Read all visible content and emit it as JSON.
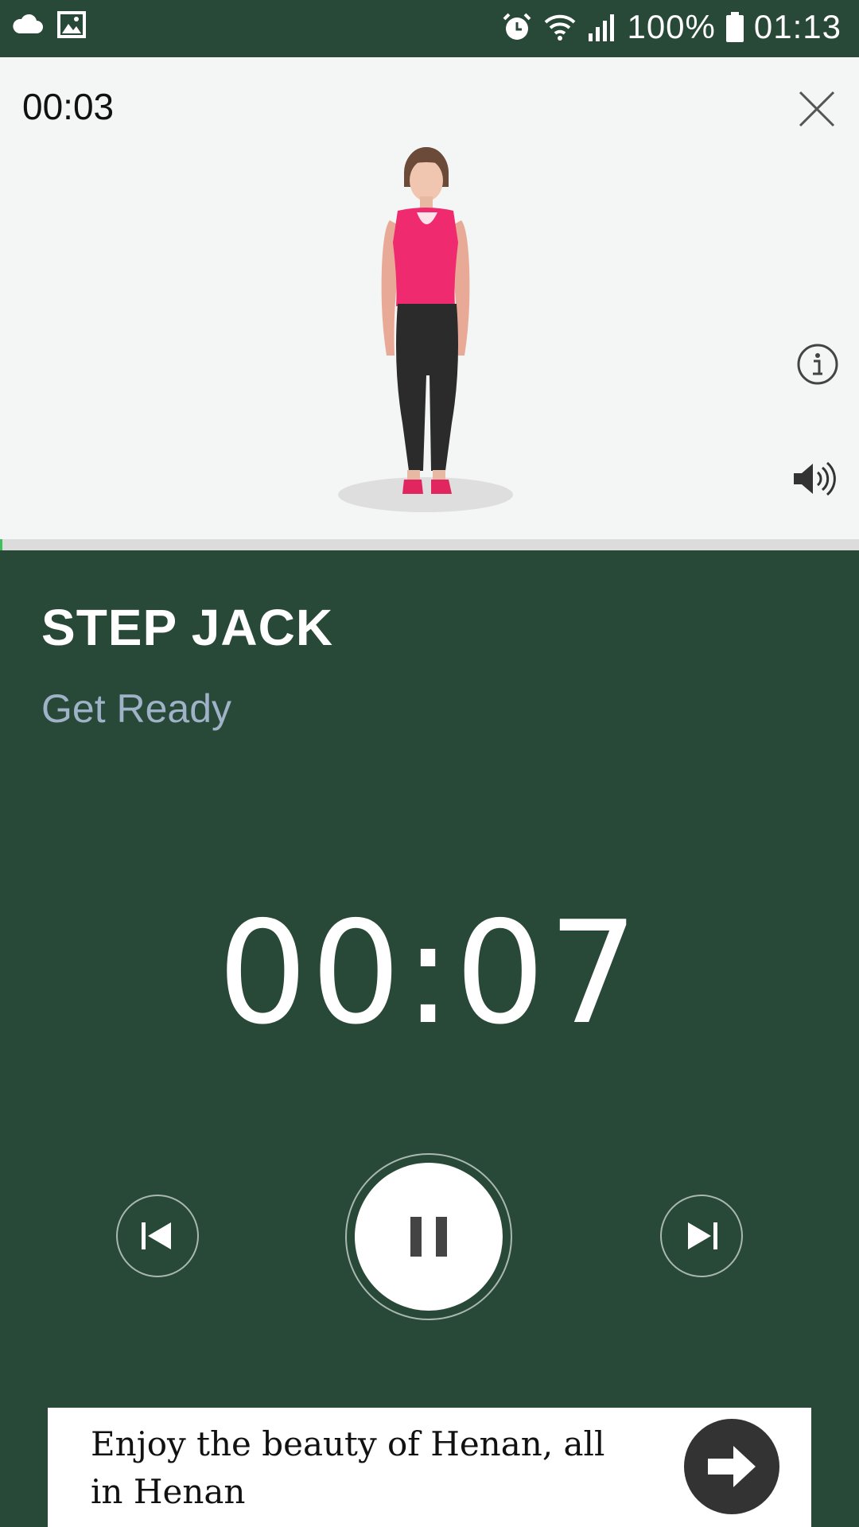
{
  "status_bar": {
    "battery": "100%",
    "time": "01:13",
    "icons": [
      "cloud-icon",
      "gallery-icon",
      "alarm-icon",
      "wifi-icon",
      "signal-icon",
      "battery-icon"
    ]
  },
  "preview": {
    "elapsed": "00:03",
    "close_icon": "close-icon",
    "info_icon": "info-icon",
    "sound_icon": "volume-icon",
    "progress": 0.003
  },
  "exercise": {
    "name": "STEP JACK",
    "status": "Get Ready",
    "countdown": "00:07"
  },
  "controls": {
    "previous": "skip-previous-icon",
    "pause": "pause-icon",
    "next": "skip-next-icon"
  },
  "ad": {
    "text": "Enjoy the beauty of Henan, all in Henan",
    "arrow_icon": "arrow-right-icon"
  },
  "colors": {
    "background": "#284838",
    "subtitle": "#9fb2c8",
    "progress": "#3fbf5a",
    "top_panel": "#f4f5f5"
  }
}
